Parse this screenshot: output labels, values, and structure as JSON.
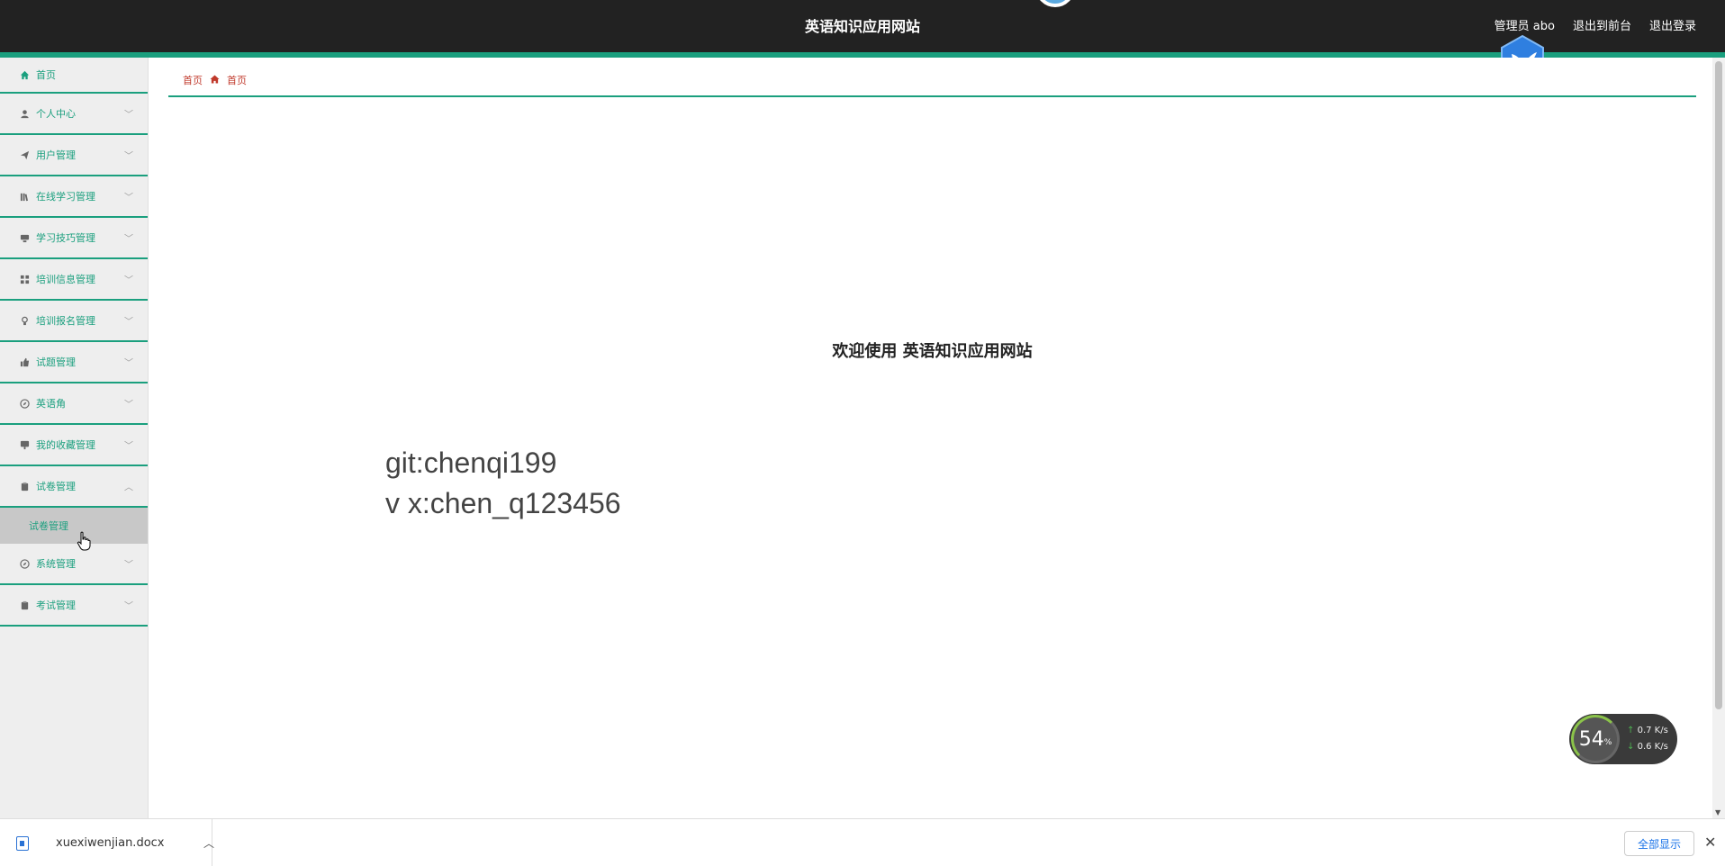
{
  "header": {
    "title": "英语知识应用网站",
    "admin_user": "管理员 abo",
    "exit_front": "退出到前台",
    "logout": "退出登录"
  },
  "sidebar": {
    "items": [
      {
        "label": "首页",
        "icon": "home-icon",
        "expanded": false
      },
      {
        "label": "个人中心",
        "icon": "user-icon",
        "expanded": false
      },
      {
        "label": "用户管理",
        "icon": "paper-plane-icon",
        "expanded": false
      },
      {
        "label": "在线学习管理",
        "icon": "library-icon",
        "expanded": false
      },
      {
        "label": "学习技巧管理",
        "icon": "desktop-icon",
        "expanded": false
      },
      {
        "label": "培训信息管理",
        "icon": "grid-icon",
        "expanded": false
      },
      {
        "label": "培训报名管理",
        "icon": "lightbulb-icon",
        "expanded": false
      },
      {
        "label": "试题管理",
        "icon": "thumbs-up-icon",
        "expanded": false
      },
      {
        "label": "英语角",
        "icon": "compass-icon",
        "expanded": false
      },
      {
        "label": "我的收藏管理",
        "icon": "monitor-icon",
        "expanded": false
      },
      {
        "label": "试卷管理",
        "icon": "clipboard-icon",
        "expanded": true
      },
      {
        "label": "系统管理",
        "icon": "compass-icon",
        "expanded": false
      },
      {
        "label": "考试管理",
        "icon": "clipboard-icon",
        "expanded": false
      }
    ],
    "submenu_label": "试卷管理"
  },
  "breadcrumb": {
    "root": "首页",
    "current": "首页"
  },
  "main": {
    "welcome": "欢迎使用 英语知识应用网站",
    "git_line": "git:chenqi199",
    "vx_line": "v x:chen_q123456"
  },
  "net_widget": {
    "percent": "54",
    "percent_unit": "%",
    "upload": "0.7",
    "download": "0.6",
    "unit": "K/s"
  },
  "download_bar": {
    "file_name": "xuexiwenjian.docx",
    "show_all": "全部显示"
  },
  "colors": {
    "accent": "#1a9f7e",
    "header_bg": "#222222",
    "breadcrumb": "#c0392b"
  }
}
